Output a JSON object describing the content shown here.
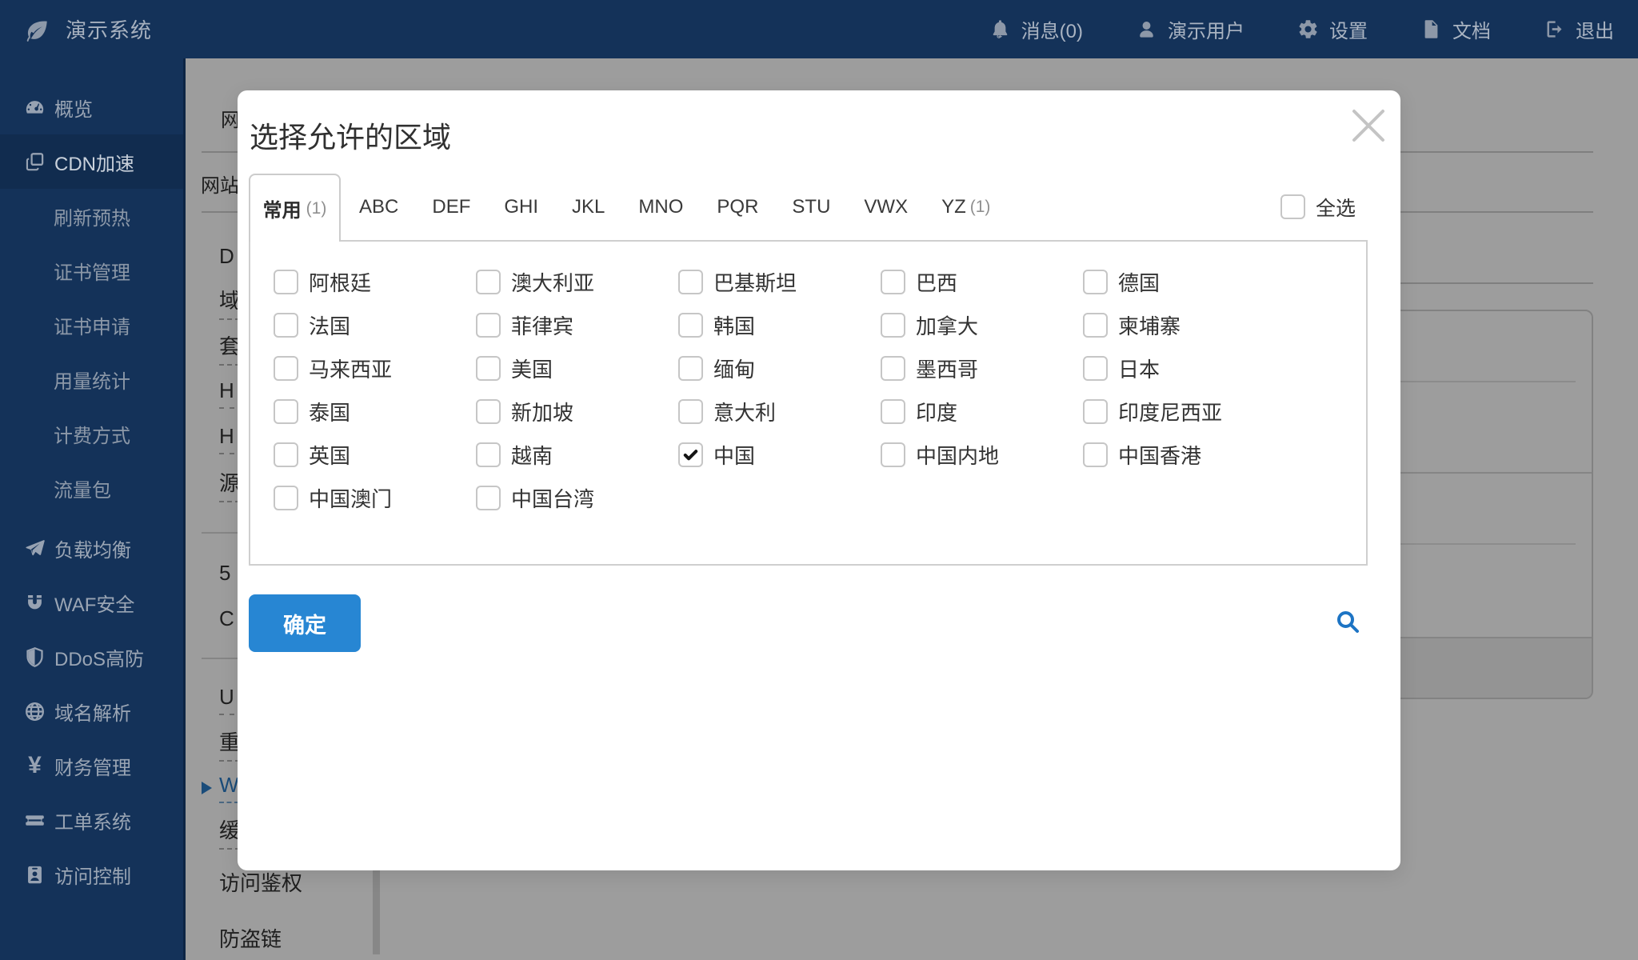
{
  "app": {
    "brand": "演示系统"
  },
  "topbar": {
    "items": [
      {
        "icon": "bell-icon",
        "label": "消息(0)"
      },
      {
        "icon": "user-icon",
        "label": "演示用户"
      },
      {
        "icon": "gear-icon",
        "label": "设置"
      },
      {
        "icon": "doc-icon",
        "label": "文档"
      },
      {
        "icon": "logout-icon",
        "label": "退出"
      }
    ]
  },
  "sidebar": {
    "items": [
      {
        "icon": "dashboard-icon",
        "label": "概览"
      },
      {
        "icon": "copy-icon",
        "label": "CDN加速",
        "active": true,
        "children": [
          "刷新预热",
          "证书管理",
          "证书申请",
          "用量统计",
          "计费方式",
          "流量包"
        ]
      },
      {
        "icon": "paper-plane-icon",
        "label": "负载均衡"
      },
      {
        "icon": "magnet-icon",
        "label": "WAF安全"
      },
      {
        "icon": "shield-icon",
        "label": "DDoS高防"
      },
      {
        "icon": "globe-icon",
        "label": "域名解析"
      },
      {
        "icon": "yuan-icon",
        "label": "财务管理"
      },
      {
        "icon": "ticket-icon",
        "label": "工单系统"
      },
      {
        "icon": "id-badge-icon",
        "label": "访问控制"
      }
    ]
  },
  "background": {
    "tab": "网",
    "heading": "网站",
    "menu": [
      {
        "label": "D"
      },
      {
        "label": "域",
        "dashed": true
      },
      {
        "label": "套",
        "dashed": true
      },
      {
        "label": "H",
        "dashed": true
      },
      {
        "label": "H",
        "dashed": true
      },
      {
        "label": "源",
        "dashed": true
      },
      {
        "divider": true,
        "variant": 1
      },
      {
        "label": "5"
      },
      {
        "label": "C"
      },
      {
        "divider": true,
        "variant": 2
      },
      {
        "label": "U",
        "dashed": true,
        "tight": true
      },
      {
        "label": "重",
        "dashed": true,
        "tight": true
      },
      {
        "label": "W",
        "dashed": true,
        "active": true,
        "tight": true
      },
      {
        "label": "缓",
        "dashed": true,
        "tight": true
      },
      {
        "label": "访问鉴权",
        "firstgap": true
      },
      {
        "label": "防盗链",
        "lastgap": true
      }
    ]
  },
  "modal": {
    "title": "选择允许的区域",
    "tabs": [
      {
        "label": "常用",
        "count": "(1)",
        "active": true
      },
      {
        "label": "ABC"
      },
      {
        "label": "DEF"
      },
      {
        "label": "GHI"
      },
      {
        "label": "JKL"
      },
      {
        "label": "MNO"
      },
      {
        "label": "PQR"
      },
      {
        "label": "STU"
      },
      {
        "label": "VWX"
      },
      {
        "label": "YZ",
        "count": "(1)"
      }
    ],
    "select_all_label": "全选",
    "regions": [
      {
        "label": "阿根廷"
      },
      {
        "label": "澳大利亚"
      },
      {
        "label": "巴基斯坦"
      },
      {
        "label": "巴西"
      },
      {
        "label": "德国"
      },
      {
        "label": "法国"
      },
      {
        "label": "菲律宾"
      },
      {
        "label": "韩国"
      },
      {
        "label": "加拿大"
      },
      {
        "label": "柬埔寨"
      },
      {
        "label": "马来西亚"
      },
      {
        "label": "美国"
      },
      {
        "label": "缅甸"
      },
      {
        "label": "墨西哥"
      },
      {
        "label": "日本"
      },
      {
        "label": "泰国"
      },
      {
        "label": "新加坡"
      },
      {
        "label": "意大利"
      },
      {
        "label": "印度"
      },
      {
        "label": "印度尼西亚"
      },
      {
        "label": "英国"
      },
      {
        "label": "越南"
      },
      {
        "label": "中国",
        "checked": true
      },
      {
        "label": "中国内地"
      },
      {
        "label": "中国香港"
      },
      {
        "label": "中国澳门"
      },
      {
        "label": "中国台湾"
      }
    ],
    "confirm_label": "确定"
  },
  "colors": {
    "nav_background": "#143259",
    "nav_active_background": "#112c4f",
    "accent_blue": "#2786d3",
    "overlay": "rgba(0,0,0,0.385)"
  }
}
